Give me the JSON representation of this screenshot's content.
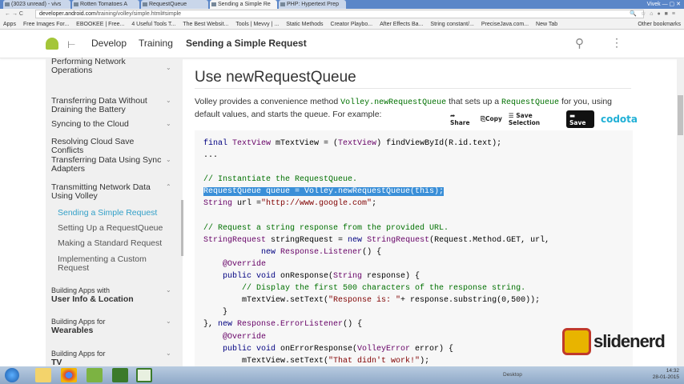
{
  "browser": {
    "tabs": [
      "(3023 unread) - vivs",
      "Rotten Tomatoes A",
      "RequestQueue",
      "Sending a Simple Re",
      "PHP: Hypertext Prep"
    ],
    "window_user": "Vivek",
    "url_host": "developer.android.com",
    "url_path": "/training/volley/simple.html#simple",
    "bookmarks": [
      "Apps",
      "Free Images For...",
      "EBOOKEE | Free...",
      "4 Useful Tools T...",
      "The Best Websit...",
      "Tools | Mevvy | ...",
      "Static Methods",
      "Creator Playbo...",
      "After Effects Ba...",
      "String constant/...",
      "PreciseJava.com...",
      "New Tab"
    ],
    "other_bookmarks": "Other bookmarks"
  },
  "header": {
    "breadcrumbs": [
      "Develop",
      "Training",
      "Sending a Simple Request"
    ]
  },
  "sidebar": {
    "items": [
      {
        "label": "Performing Network Operations",
        "chev": "⌄"
      },
      {
        "label": "Transferring Data Without Draining the Battery",
        "chev": "⌄"
      },
      {
        "label": "Syncing to the Cloud",
        "chev": "⌄"
      },
      {
        "label": "Resolving Cloud Save Conflicts",
        "chev": ""
      },
      {
        "label": "Transferring Data Using Sync Adapters",
        "chev": "⌄"
      },
      {
        "label": "Transmitting Network Data Using Volley",
        "chev": "⌃"
      },
      {
        "label": "Sending a Simple Request",
        "sub": true,
        "selected": true
      },
      {
        "label": "Setting Up a RequestQueue",
        "sub": true
      },
      {
        "label": "Making a Standard Request",
        "sub": true
      },
      {
        "label": "Implementing a Custom Request",
        "sub": true
      },
      {
        "label": "Building Apps with",
        "bold": "User Info & Location",
        "chev": "⌄"
      },
      {
        "label": "Building Apps for",
        "bold": "Wearables",
        "chev": "⌄"
      },
      {
        "label": "Building Apps for",
        "bold": "TV",
        "chev": "⌄"
      }
    ]
  },
  "main": {
    "title": "Use newRequestQueue",
    "para": [
      "Volley provides a convenience method ",
      "Volley.newRequestQueue",
      " that sets up a ",
      "RequestQueue",
      " for you, using default values, and starts the queue. For example:"
    ],
    "codota": {
      "share": "Share",
      "copy": "Copy",
      "save_selection": "Save Selection",
      "save": "Save",
      "brand": "codota"
    },
    "code": [
      [
        [
          "final ",
          "k"
        ],
        [
          "TextView",
          "t"
        ],
        [
          " mTextView = (",
          ""
        ],
        [
          "TextView",
          "t"
        ],
        [
          ") findViewById(R.id.text);",
          ""
        ]
      ],
      [
        [
          "...",
          ""
        ]
      ],
      [],
      [
        [
          "// Instantiate the RequestQueue.",
          "c"
        ]
      ],
      [
        [
          "RequestQueue queue = Volley.newRequestQueue(this);",
          "hl"
        ]
      ],
      [
        [
          "String",
          "t"
        ],
        [
          " url =",
          ""
        ],
        [
          "\"http://www.google.com\"",
          "s"
        ],
        [
          ";",
          ""
        ]
      ],
      [],
      [
        [
          "// Request a string response from the provided URL.",
          "c"
        ]
      ],
      [
        [
          "StringRequest",
          "t"
        ],
        [
          " stringRequest = ",
          ""
        ],
        [
          "new ",
          "k"
        ],
        [
          "StringRequest",
          "t"
        ],
        [
          "(Request.Method.GET, url,",
          ""
        ]
      ],
      [
        [
          "            ",
          ""
        ],
        [
          "new ",
          "k"
        ],
        [
          "Response.Listener",
          "t"
        ],
        [
          "() {",
          ""
        ]
      ],
      [
        [
          "    @Override",
          "a"
        ]
      ],
      [
        [
          "    public void ",
          "k"
        ],
        [
          "onResponse(",
          ""
        ],
        [
          "String",
          "t"
        ],
        [
          " response) {",
          ""
        ]
      ],
      [
        [
          "        // Display the first 500 characters of the response string.",
          "c"
        ]
      ],
      [
        [
          "        mTextView.setText(",
          ""
        ],
        [
          "\"Response is: \"",
          "s"
        ],
        [
          "+ response.substring(0,500));",
          ""
        ]
      ],
      [
        [
          "    }",
          ""
        ]
      ],
      [
        [
          "}, ",
          ""
        ],
        [
          "new ",
          "k"
        ],
        [
          "Response.ErrorListener",
          "t"
        ],
        [
          "() {",
          ""
        ]
      ],
      [
        [
          "    @Override",
          "a"
        ]
      ],
      [
        [
          "    public void ",
          "k"
        ],
        [
          "onErrorResponse(",
          ""
        ],
        [
          "VolleyError",
          "t"
        ],
        [
          " error) {",
          ""
        ]
      ],
      [
        [
          "        mTextView.setText(",
          ""
        ],
        [
          "\"That didn't work!\"",
          "s"
        ],
        [
          ");",
          ""
        ]
      ]
    ]
  },
  "watermark": "slidenerd",
  "taskbar": {
    "desktop": "Desktop",
    "time": "14:32",
    "date": "28-01-2015"
  }
}
